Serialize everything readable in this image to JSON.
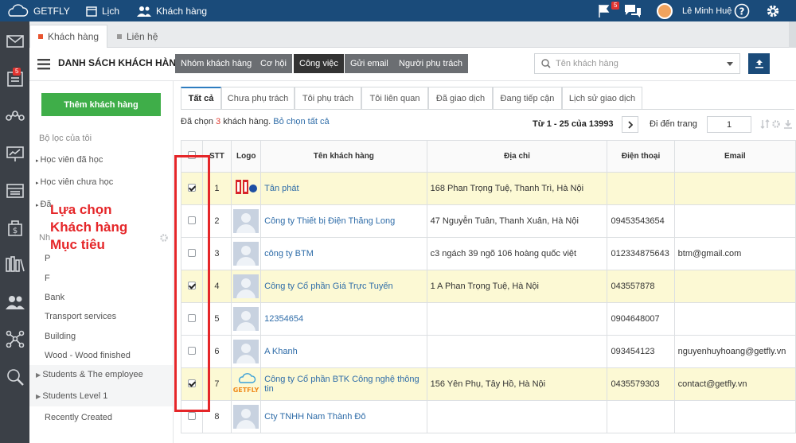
{
  "topbar": {
    "brand": "GETFLY",
    "calendar": "Lịch",
    "customers": "Khách hàng",
    "flag_count": "5",
    "user": "Lê Minh Huệ"
  },
  "rail": {
    "doc_badge": "5"
  },
  "window_tabs": [
    {
      "label": "Khách hàng"
    },
    {
      "label": "Liên hệ"
    }
  ],
  "header": {
    "title": "DANH SÁCH KHÁCH HÀNG",
    "buttons": [
      "Nhóm khách hàng",
      "Cơ hội",
      "Công việc",
      "Gửi email",
      "Người phụ trách"
    ],
    "search_placeholder": "Tên khách hàng"
  },
  "sidebar": {
    "add_button": "Thêm khách hàng",
    "filter_heading": "Bộ lọc của tôi",
    "filters": [
      "Học viên đã học",
      "Học viên chưa học",
      "Đã"
    ],
    "group_heading": "Nh",
    "groups": [
      "P",
      "F",
      "Bank",
      "Transport services",
      "Building",
      "Wood - Wood finished",
      "Students & The employee",
      "Students Level 1",
      "Recently Created"
    ]
  },
  "annotation": {
    "line1": "Lựa chọn",
    "line2": "Khách hàng",
    "line3": "Mục tiêu"
  },
  "tabs": [
    "Tất cả",
    "Chưa phụ trách",
    "Tôi phụ trách",
    "Tôi liên quan",
    "Đã giao dịch",
    "Đang tiếp cận",
    "Lịch sử giao dịch"
  ],
  "selection": {
    "prefix": "Đã chọn",
    "count": "3",
    "suffix": "khách hàng.",
    "clear_link": "Bỏ chọn tất cả"
  },
  "pager": {
    "range": "Từ 1 - 25 của 13993",
    "goto_label": "Đi đến trang",
    "page": "1"
  },
  "table": {
    "headers": {
      "stt": "STT",
      "logo": "Logo",
      "name": "Tên khách hàng",
      "address": "Địa chỉ",
      "phone": "Điện thoại",
      "email": "Email"
    },
    "rows": [
      {
        "stt": "1",
        "name": "Tân phát",
        "address": "168 Phan Trọng Tuệ, Thanh Trì, Hà Nội",
        "phone": "",
        "email": "",
        "selected": true,
        "logo": "tanphat"
      },
      {
        "stt": "2",
        "name": "Công ty Thiết bị Điện Thăng Long",
        "address": "47 Nguyễn Tuân, Thanh Xuân, Hà Nội",
        "phone": "09453543654",
        "email": "",
        "selected": false,
        "logo": "avatar"
      },
      {
        "stt": "3",
        "name": "công ty BTM",
        "address": "c3 ngách 39 ngõ 106 hoàng quốc việt",
        "phone": "012334875643",
        "email": "btm@gmail.com",
        "selected": false,
        "logo": "avatar"
      },
      {
        "stt": "4",
        "name": "Công ty Cổ phần Giá Trực Tuyến",
        "address": "1 A Phan Trọng Tuệ, Hà Nội",
        "phone": "043557878",
        "email": "",
        "selected": true,
        "logo": "avatar"
      },
      {
        "stt": "5",
        "name": "12354654",
        "address": "",
        "phone": "0904648007",
        "email": "",
        "selected": false,
        "logo": "avatar"
      },
      {
        "stt": "6",
        "name": "A Khanh",
        "address": "",
        "phone": "093454123",
        "email": "nguyenhuyhoang@getfly.vn",
        "selected": false,
        "logo": "avatar"
      },
      {
        "stt": "7",
        "name": "Công ty Cổ phần BTK Công nghệ thông tin",
        "address": "156 Yên Phụ, Tây Hồ, Hà Nội",
        "phone": "0435579303",
        "email": "contact@getfly.vn",
        "selected": true,
        "logo": "getfly"
      },
      {
        "stt": "8",
        "name": "Cty TNHH Nam Thành Đô",
        "address": "",
        "phone": "",
        "email": "",
        "selected": false,
        "logo": "avatar"
      }
    ]
  }
}
